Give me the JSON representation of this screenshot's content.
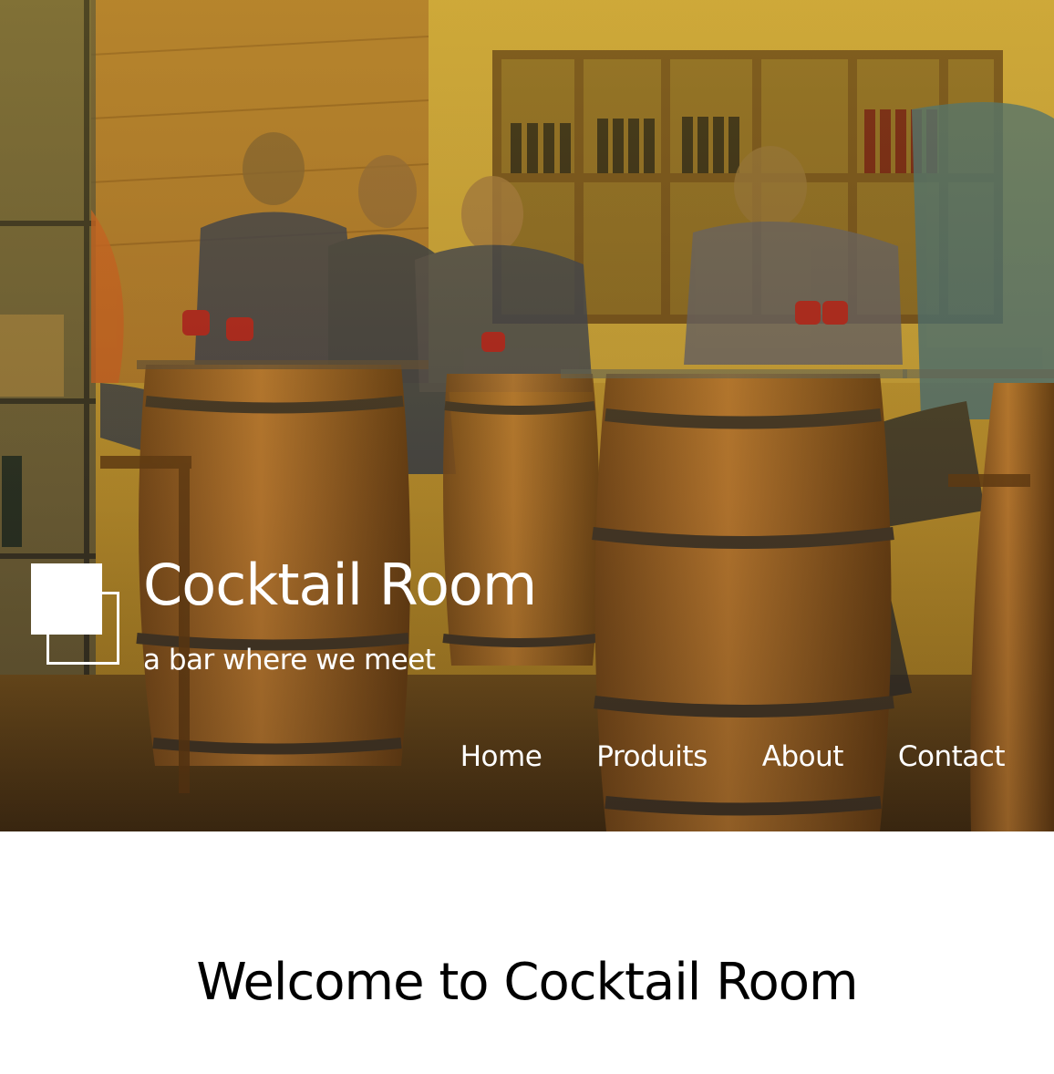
{
  "header": {
    "site_title": "Cocktail Room",
    "tagline": "a bar where we meet"
  },
  "nav": {
    "items": [
      {
        "label": "Home"
      },
      {
        "label": "Produits"
      },
      {
        "label": "About"
      },
      {
        "label": "Contact"
      }
    ]
  },
  "main": {
    "heading": "Welcome to Cocktail Room"
  },
  "colors": {
    "header_text": "#ffffff",
    "body_text": "#000000",
    "hero_tint": "#b98a2c",
    "page_background": "#ffffff"
  },
  "icons": {
    "logo": "two-overlapping-squares-icon"
  }
}
